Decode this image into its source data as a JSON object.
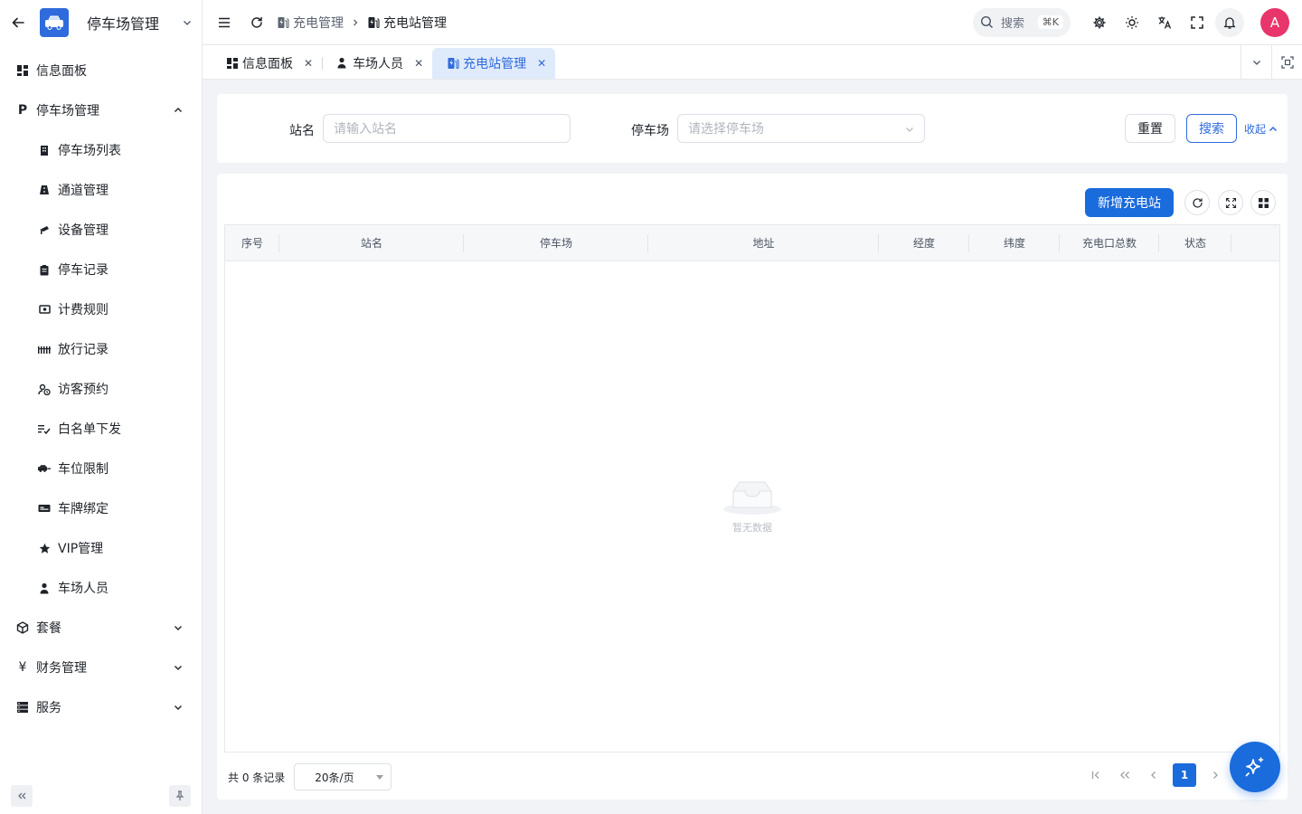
{
  "sidebar": {
    "title": "停车场管理",
    "items": [
      {
        "label": "信息面板",
        "icon": "dashboard-icon",
        "level": 0
      },
      {
        "label": "停车场管理",
        "icon": "parking-p-icon",
        "level": 0,
        "expanded": true
      },
      {
        "label": "停车场列表",
        "icon": "building-icon",
        "level": 1
      },
      {
        "label": "通道管理",
        "icon": "road-icon",
        "level": 1
      },
      {
        "label": "设备管理",
        "icon": "camera-icon",
        "level": 1
      },
      {
        "label": "停车记录",
        "icon": "clipboard-icon",
        "level": 1
      },
      {
        "label": "计费规则",
        "icon": "money-icon",
        "level": 1
      },
      {
        "label": "放行记录",
        "icon": "fence-icon",
        "level": 1
      },
      {
        "label": "访客预约",
        "icon": "visitor-icon",
        "level": 1
      },
      {
        "label": "白名单下发",
        "icon": "list-check-icon",
        "level": 1
      },
      {
        "label": "车位限制",
        "icon": "car-limit-icon",
        "level": 1
      },
      {
        "label": "车牌绑定",
        "icon": "plate-icon",
        "level": 1
      },
      {
        "label": "VIP管理",
        "icon": "star-icon",
        "level": 1
      },
      {
        "label": "车场人员",
        "icon": "person-icon",
        "level": 1
      },
      {
        "label": "套餐",
        "icon": "package-icon",
        "level": 0,
        "expanded": false
      },
      {
        "label": "财务管理",
        "icon": "yen-icon",
        "level": 0,
        "expanded": false
      },
      {
        "label": "服务",
        "icon": "server-icon",
        "level": 0,
        "expanded": false
      }
    ]
  },
  "header": {
    "breadcrumb": [
      "充电管理",
      "充电站管理"
    ],
    "search_label": "搜索",
    "search_shortcut": "⌘K",
    "avatar_letter": "A"
  },
  "tabs": [
    {
      "label": "信息面板",
      "icon": "dashboard-icon",
      "active": false
    },
    {
      "label": "车场人员",
      "icon": "person-icon",
      "active": false
    },
    {
      "label": "充电站管理",
      "icon": "charging-icon",
      "active": true
    }
  ],
  "filter": {
    "station_label": "站名",
    "station_placeholder": "请输入站名",
    "parking_label": "停车场",
    "parking_placeholder": "请选择停车场",
    "reset_label": "重置",
    "search_label": "搜索",
    "collapse_label": "收起"
  },
  "table": {
    "add_label": "新增充电站",
    "columns": [
      "序号",
      "站名",
      "停车场",
      "地址",
      "经度",
      "纬度",
      "充电口总数",
      "状态",
      ""
    ],
    "rows": [],
    "empty_text": "暂无数据"
  },
  "pagination": {
    "total_text": "共 0 条记录",
    "page_size": "20条/页",
    "current_page": "1"
  },
  "colors": {
    "primary": "#1a6bdc",
    "avatar": "#e8356b",
    "active_tab_bg": "#dfeafb"
  }
}
